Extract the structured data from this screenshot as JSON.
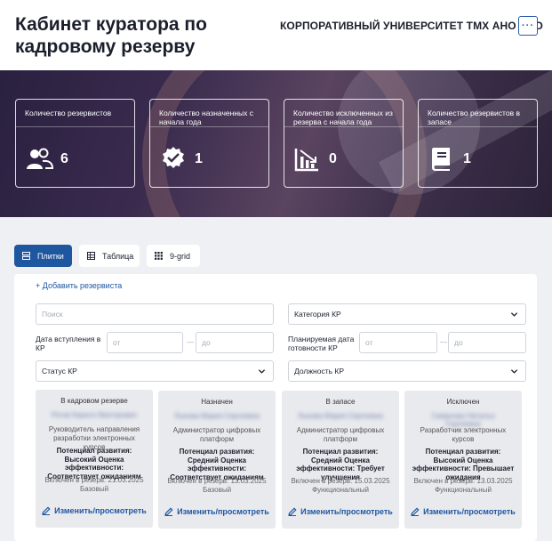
{
  "header": {
    "title": "Кабинет куратора по кадровому резерву",
    "org": "КОРПОРАТИВНЫЙ УНИВЕРСИТЕТ ТМХ АНО ДПО",
    "more_label": "···"
  },
  "stats": [
    {
      "label": "Количество резервистов",
      "value": "6",
      "icon": "users-icon"
    },
    {
      "label": "Количество назначенных с начала года",
      "value": "1",
      "icon": "badge-check-icon"
    },
    {
      "label": "Количество исключенных из резерва с начала года",
      "value": "0",
      "icon": "chart-down-icon"
    },
    {
      "label": "Количество резервистов в запасе",
      "value": "1",
      "icon": "book-icon"
    }
  ],
  "views": [
    {
      "label": "Плитки",
      "icon": "tiles-icon",
      "active": true
    },
    {
      "label": "Таблица",
      "icon": "table-icon",
      "active": false
    },
    {
      "label": "9-grid",
      "icon": "grid-icon",
      "active": false
    }
  ],
  "add_reservist": "+ Добавить резервиста",
  "filters": {
    "search_placeholder": "Поиск",
    "category": "Категория КР",
    "join_date_label": "Дата вступления в КР",
    "readiness_date_label": "Планируемая дата готовности КР",
    "from_placeholder": "от",
    "to_placeholder": "до",
    "dash": "—",
    "status": "Статус КР",
    "position": "Должность КР"
  },
  "cards": [
    {
      "status": "В кадровом резерве",
      "name": "Рогов Кирилл Викторович",
      "position": "Руководитель направления разработки электронных курсов",
      "assessment": "Потенциал развития: Высокий Оценка эффективности: Соответствует ожиданиям",
      "included": "Включен в резерв: 21.03.2025",
      "level": "Базовый",
      "edit": "Изменить/просмотреть"
    },
    {
      "status": "Назначен",
      "name": "Лыкова Мария Сергеевна",
      "position": "Администратор цифровых платформ",
      "assessment": "Потенциал развития: Средний Оценка эффективности: Соответствует ожиданиям",
      "included": "Включен в резерв: 13.03.2025",
      "level": "Базовый",
      "edit": "Изменить/просмотреть"
    },
    {
      "status": "В запасе",
      "name": "Лыкова Мария Сергеевна",
      "position": "Администратор цифровых платформ",
      "assessment": "Потенциал развития: Средний Оценка эффективности: Требует улучшения",
      "included": "Включен в резерв: 15.03.2025",
      "level": "Функциональный",
      "edit": "Изменить/просмотреть"
    },
    {
      "status": "Исключен",
      "name": "Смирнова Наталья Сергеевна",
      "position": "Разработчик электронных курсов",
      "assessment": "Потенциал развития: Высокий Оценка эффективности: Превышает ожидания",
      "included": "Включен в резерв: 13.03.2025",
      "level": "Функциональный",
      "edit": "Изменить/просмотреть"
    }
  ]
}
